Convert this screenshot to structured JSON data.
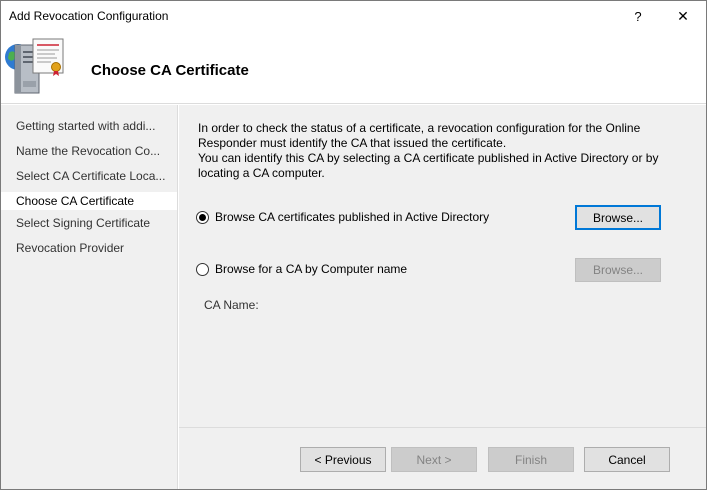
{
  "window": {
    "title": "Add Revocation Configuration",
    "help_glyph": "?",
    "close_glyph": "✕"
  },
  "header": {
    "title": "Choose CA Certificate",
    "icon": "server-certificate-icon"
  },
  "nav": {
    "items": [
      {
        "label": "Getting started with addi...",
        "active": false
      },
      {
        "label": "Name the Revocation Co...",
        "active": false
      },
      {
        "label": "Select CA Certificate Loca...",
        "active": false
      },
      {
        "label": "Choose CA Certificate",
        "active": true
      },
      {
        "label": "Select Signing Certificate",
        "active": false
      },
      {
        "label": "Revocation Provider",
        "active": false
      }
    ]
  },
  "content": {
    "intro_line1": "In order to check the status of a certificate, a revocation configuration for the Online",
    "intro_line2": "Responder must identify the CA that issued the certificate.",
    "intro_line3": "You can identify this CA by selecting a CA certificate published in Active Directory or by",
    "intro_line4": "locating a CA computer.",
    "option_ad": {
      "label": "Browse CA certificates published in Active Directory",
      "checked": true
    },
    "option_computer": {
      "label": "Browse for a CA by Computer name",
      "checked": false
    },
    "browse_ad_label": "Browse...",
    "browse_computer_label": "Browse...",
    "ca_name_label": "CA Name:"
  },
  "footer": {
    "previous_label": "< Previous",
    "next_label": "Next >",
    "finish_label": "Finish",
    "cancel_label": "Cancel"
  },
  "colors": {
    "accent": "#0078d7",
    "panel_bg": "#f0f0f0",
    "button_bg": "#e1e1e1",
    "disabled_text": "#838383"
  }
}
